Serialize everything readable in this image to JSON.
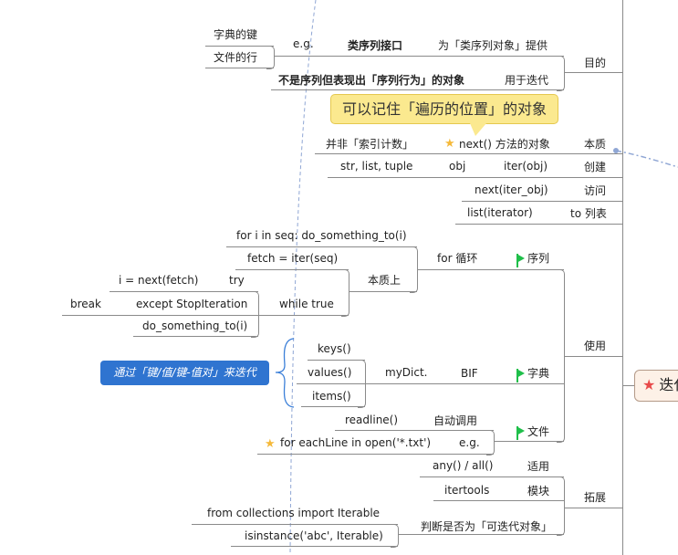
{
  "center": {
    "label": "迭代",
    "icon": "red-star-icon"
  },
  "purpose": {
    "label": "目的",
    "branch1": {
      "label": "为「类序列对象」提供",
      "child": "类序列接口",
      "eg": "e.g.",
      "examples": [
        "字典的键",
        "文件的行"
      ]
    },
    "branch2": {
      "label": "用于迭代",
      "child": "不是序列但表现出「序列行为」的对象"
    }
  },
  "callout": "可以记住「遍历的位置」的对象",
  "essence": {
    "label": "本质",
    "child": "next() 方法的对象",
    "grandchild": "并非「索引计数」"
  },
  "create": {
    "label": "创建",
    "child": "iter(obj)",
    "grandchild": "obj",
    "leaf": "str, list, tuple"
  },
  "access": {
    "label": "访问",
    "child": "next(iter_obj)"
  },
  "tolist": {
    "label": "to 列表",
    "child": "list(iterator)"
  },
  "use": {
    "label": "使用",
    "sequence": {
      "label": "序列",
      "child": "for 循环",
      "essence": "本质上",
      "for_stmt": "for i in seq: do_something_to(i)",
      "fetch": "fetch = iter(seq)",
      "while": "while true",
      "try": "try",
      "next": "i = next(fetch)",
      "except": "except StopIteration",
      "break": "break",
      "do": "do_something_to(i)"
    },
    "dict": {
      "label": "字典",
      "bif": "BIF",
      "mydict": "myDict.",
      "methods": [
        "keys()",
        "values()",
        "items()"
      ],
      "note": "通过「键/值/键-值对」来迭代"
    },
    "file": {
      "label": "文件",
      "auto": "自动调用",
      "readline": "readline()",
      "eg": "e.g.",
      "example": "for eachLine in open('*.txt')"
    }
  },
  "extend": {
    "label": "拓展",
    "apply": {
      "label": "适用",
      "child": "any() / all()"
    },
    "module": {
      "label": "模块",
      "child": "itertools"
    },
    "check": {
      "label": "判断是否为「可迭代对象」",
      "children": [
        "from collections import Iterable",
        "isinstance('abc', Iterable)"
      ]
    }
  },
  "colors": {
    "accent_blue": "#2f74d0",
    "flag_green": "#1fbf4a",
    "callout_yellow": "#fbe98f",
    "star_red": "#e84a4a"
  }
}
